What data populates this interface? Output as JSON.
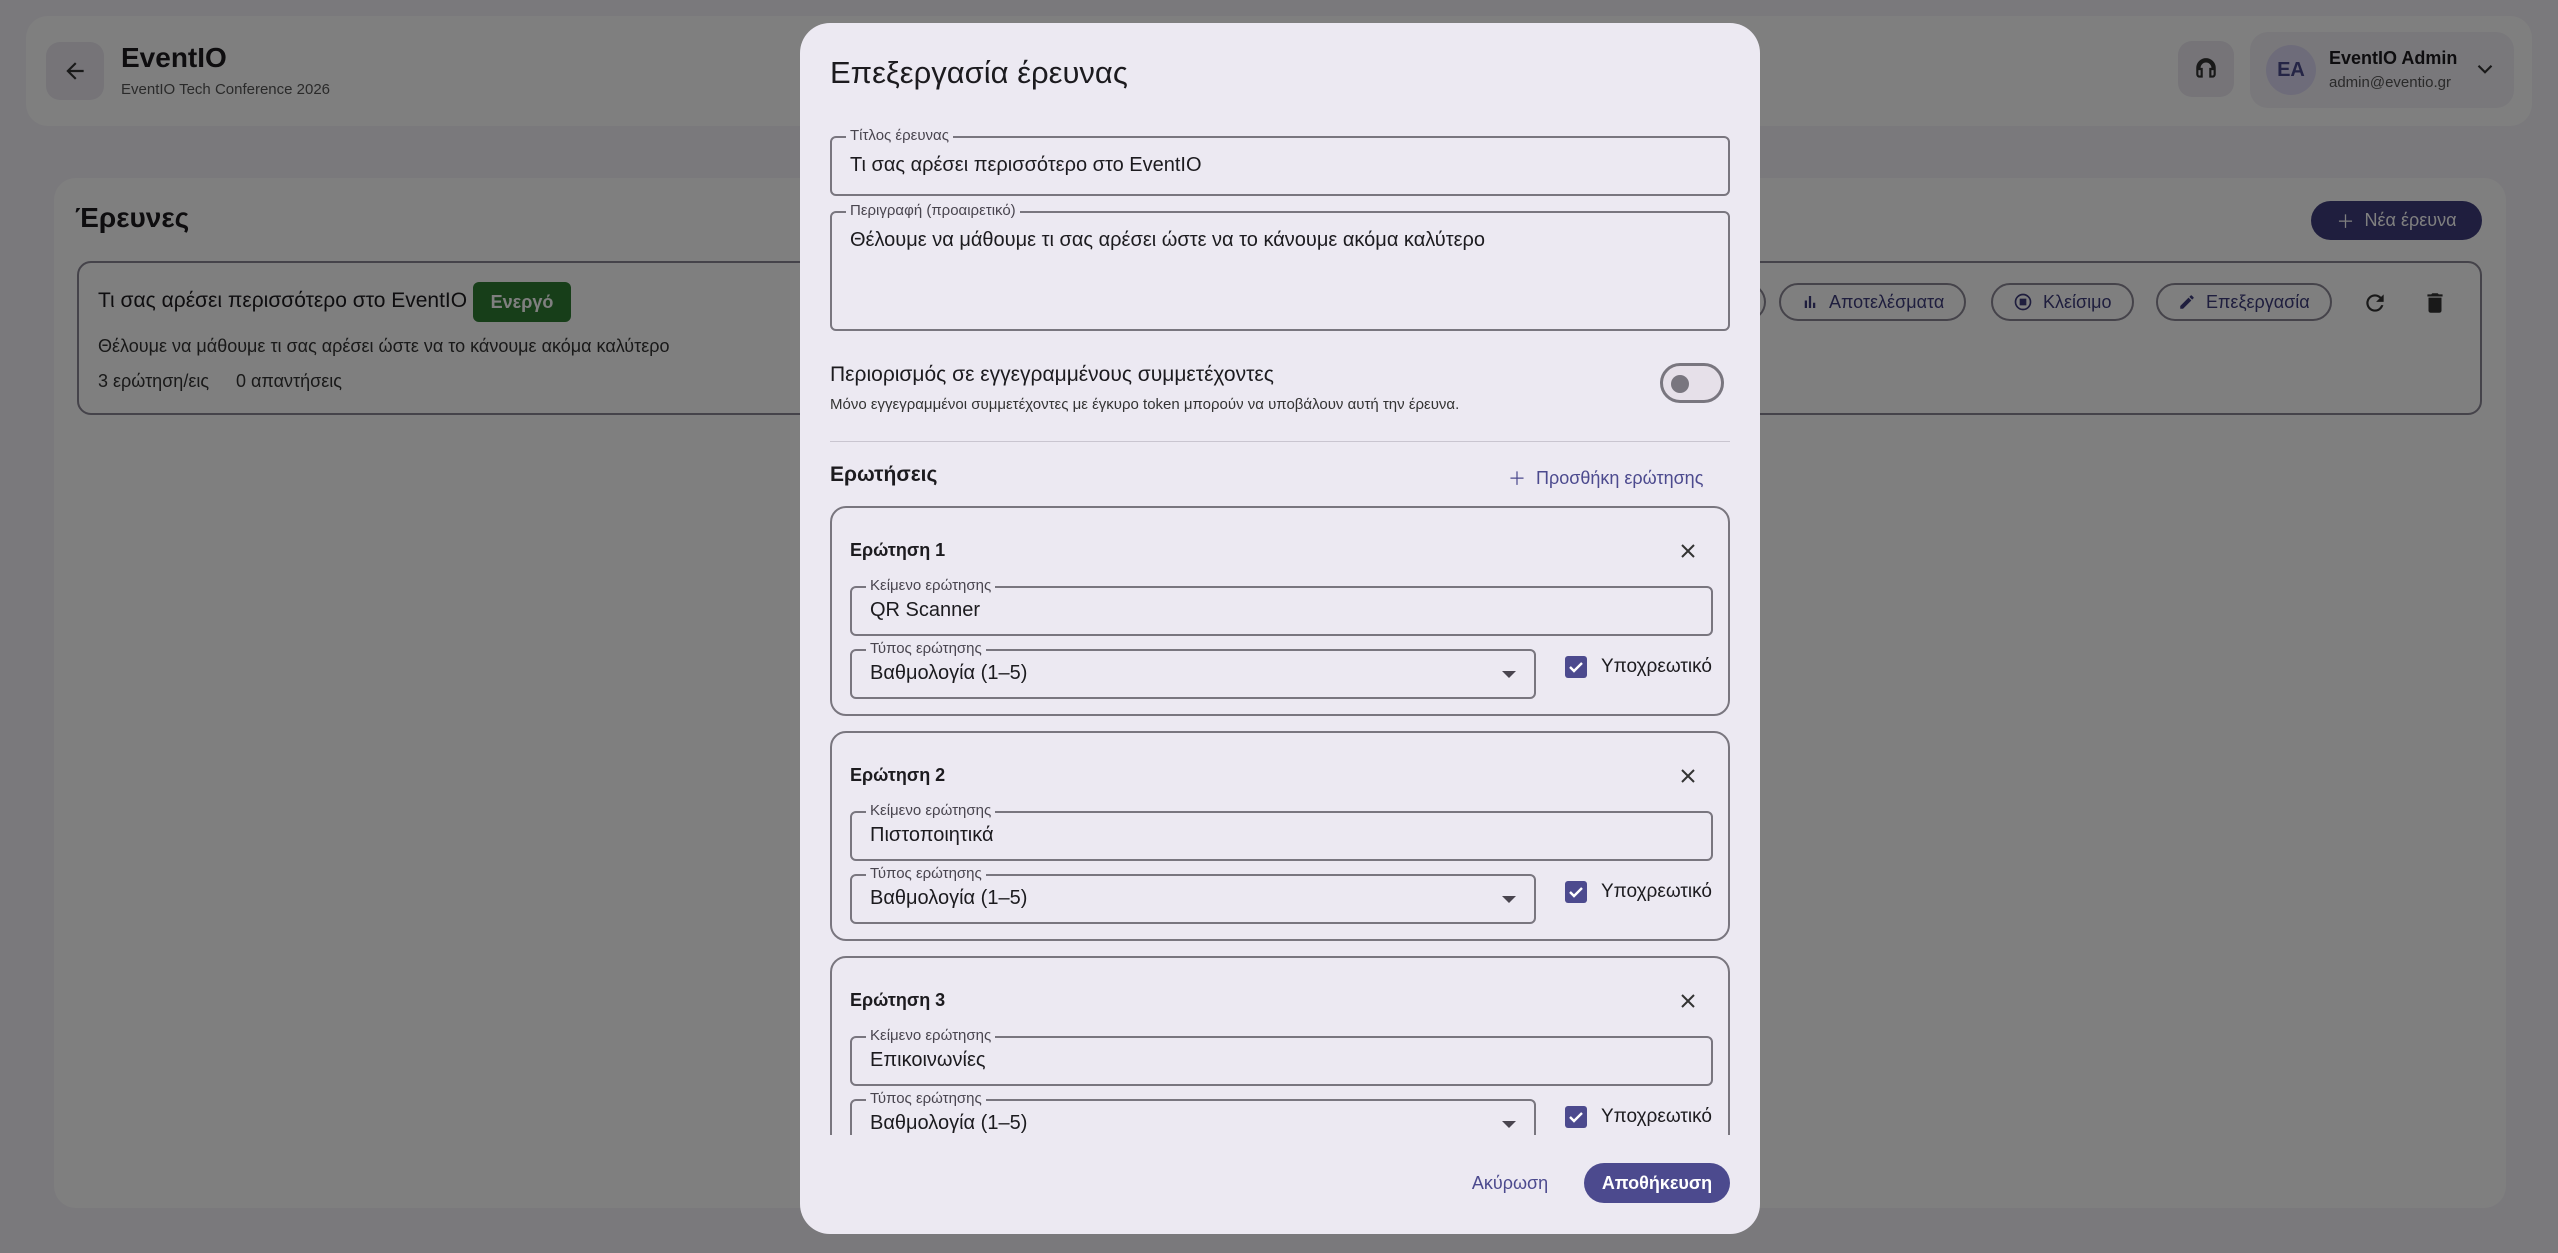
{
  "app": {
    "title": "EventIO",
    "subtitle": "EventIO Tech Conference 2026"
  },
  "user": {
    "initials": "EA",
    "name": "EventIO Admin",
    "email": "admin@eventio.gr"
  },
  "page": {
    "title": "Έρευνες",
    "new_survey_label": "Νέα έρευνα"
  },
  "survey_card": {
    "title": "Τι σας αρέσει περισσότερο στο EventIO",
    "status": "Ενεργό",
    "description": "Θέλουμε να μάθουμε τι σας αρέσει ώστε να το κάνουμε ακόμα καλύτερο",
    "question_count": "3 ερώτηση/εις",
    "answer_count": "0 απαντήσεις",
    "actions": {
      "results": "Αποτελέσματα",
      "close": "Κλείσιμο",
      "edit": "Επεξεργασία"
    }
  },
  "dialog": {
    "title": "Επεξεργασία έρευνας",
    "fields": {
      "title_label": "Τίτλος έρευνας",
      "title_value": "Τι σας αρέσει περισσότερο στο EventIO",
      "description_label": "Περιγραφή (προαιρετικό)",
      "description_value": "Θέλουμε να μάθουμε τι σας αρέσει ώστε να το κάνουμε ακόμα καλύτερο"
    },
    "restrict": {
      "title": "Περιορισμός σε εγγεγραμμένους συμμετέχοντες",
      "subtitle": "Μόνο εγγεγραμμένοι συμμετέχοντες με έγκυρο token μπορούν να υποβάλουν αυτή την έρευνα.",
      "enabled": false
    },
    "questions_heading": "Ερωτήσεις",
    "add_question_label": "Προσθήκη ερώτησης",
    "questions": [
      {
        "label": "Ερώτηση 1",
        "text_label": "Κείμενο ερώτησης",
        "text_value": "QR Scanner",
        "type_label": "Τύπος ερώτησης",
        "type_value": "Βαθμολογία (1–5)",
        "required_label": "Υποχρεωτικό",
        "required": true
      },
      {
        "label": "Ερώτηση 2",
        "text_label": "Κείμενο ερώτησης",
        "text_value": "Πιστοποιητικά",
        "type_label": "Τύπος ερώτησης",
        "type_value": "Βαθμολογία (1–5)",
        "required_label": "Υποχρεωτικό",
        "required": true
      },
      {
        "label": "Ερώτηση 3",
        "text_label": "Κείμενο ερώτησης",
        "text_value": "Επικοινωνίες",
        "type_label": "Τύπος ερώτησης",
        "type_value": "Βαθμολογία (1–5)",
        "required_label": "Υποχρεωτικό",
        "required": true
      }
    ],
    "cancel_label": "Ακύρωση",
    "save_label": "Αποθήκευση"
  },
  "colors": {
    "primary": "#4c4a8e",
    "status_active": "#2e7d32",
    "dialog_bg": "#ece9f2"
  },
  "icons": [
    "arrow-back-icon",
    "headset-icon",
    "chevron-down-icon",
    "plus-icon",
    "bar-chart-icon",
    "stop-circle-icon",
    "pencil-icon",
    "refresh-icon",
    "trash-icon",
    "close-icon",
    "dropdown-arrow-icon",
    "check-icon"
  ]
}
